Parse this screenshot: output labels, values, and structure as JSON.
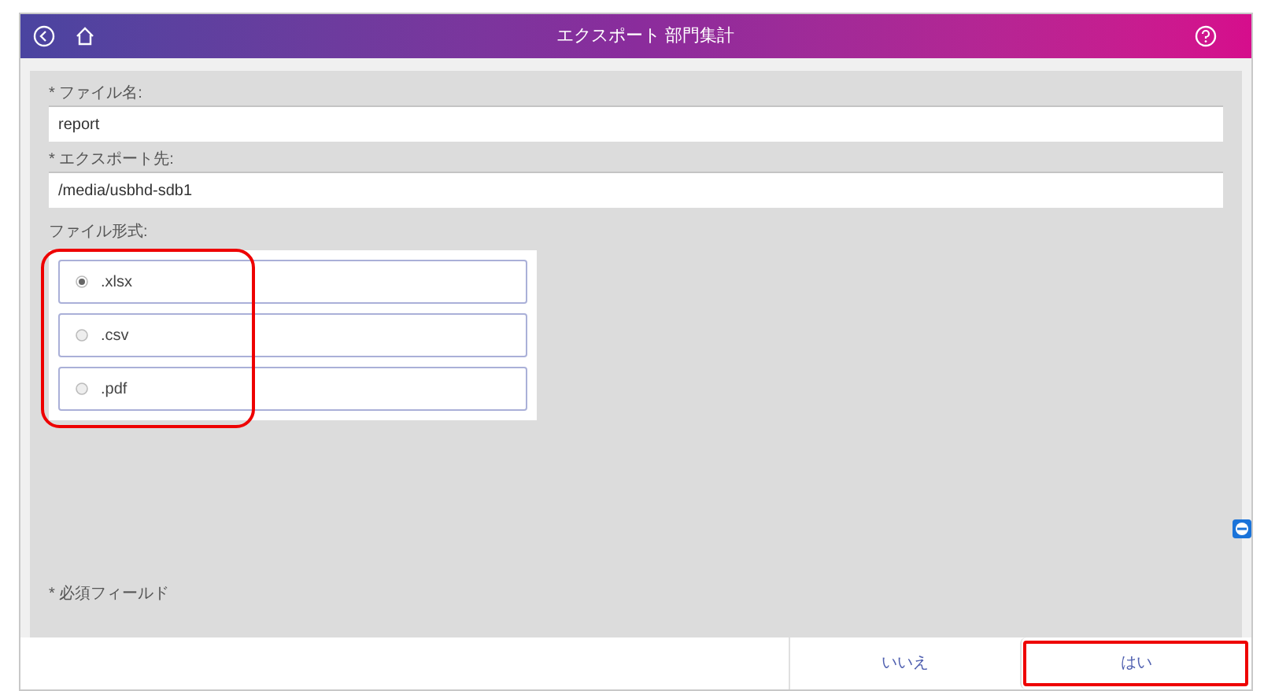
{
  "header": {
    "title": "エクスポート 部門集計"
  },
  "fields": [
    {
      "label": "* ファイル名:",
      "value": "report"
    },
    {
      "label": "* エクスポート先:",
      "value": "/media/usbhd-sdb1"
    }
  ],
  "format": {
    "label": "ファイル形式:",
    "options": [
      {
        "label": ".xlsx",
        "selected": true
      },
      {
        "label": ".csv",
        "selected": false
      },
      {
        "label": ".pdf",
        "selected": false
      }
    ]
  },
  "note": "* 必須フィールド",
  "buttons": [
    {
      "label": "いいえ",
      "highlighted": false
    },
    {
      "label": "はい",
      "highlighted": true
    }
  ]
}
